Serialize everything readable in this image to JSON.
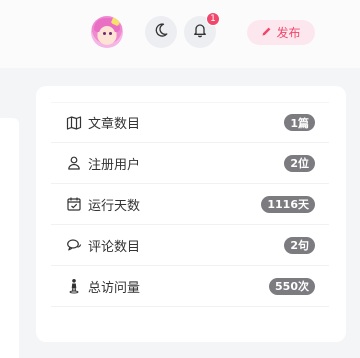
{
  "header": {
    "notification_count": "1",
    "publish_label": "发布"
  },
  "stats": [
    {
      "icon": "map-icon",
      "label": "文章数目",
      "value": "1篇"
    },
    {
      "icon": "user-icon",
      "label": "注册用户",
      "value": "2位"
    },
    {
      "icon": "calendar-icon",
      "label": "运行天数",
      "value": "1116天"
    },
    {
      "icon": "comment-icon",
      "label": "评论数目",
      "value": "2句"
    },
    {
      "icon": "visitor-icon",
      "label": "总访问量",
      "value": "550次"
    }
  ],
  "colors": {
    "accent": "#f0476a",
    "accent_bg": "#fde7ee",
    "badge_bg": "#7b7b80"
  }
}
